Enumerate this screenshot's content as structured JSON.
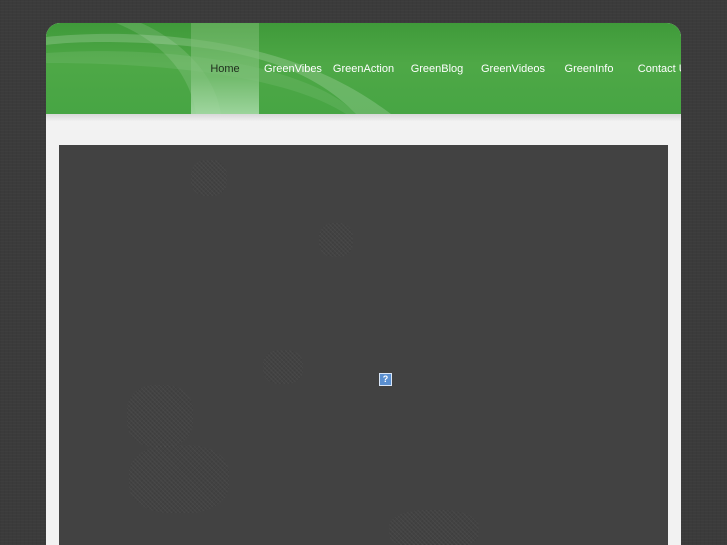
{
  "nav": {
    "items": [
      {
        "label": "Home",
        "active": true
      },
      {
        "label": "GreenVibes",
        "active": false
      },
      {
        "label": "GreenAction",
        "active": false
      },
      {
        "label": "GreenBlog",
        "active": false
      },
      {
        "label": "GreenVideos",
        "active": false
      },
      {
        "label": "GreenInfo",
        "active": false
      },
      {
        "label": "Contact Us",
        "active": false
      }
    ]
  },
  "content": {
    "placeholder_glyph": "?",
    "placeholder_icon": "broken-image-icon"
  },
  "colors": {
    "header_green": "#4ea846",
    "active_tab": "#8fcc8a",
    "background": "#3b3b3b",
    "content_panel": "#424242",
    "placeholder_blue": "#5a8fd0"
  }
}
